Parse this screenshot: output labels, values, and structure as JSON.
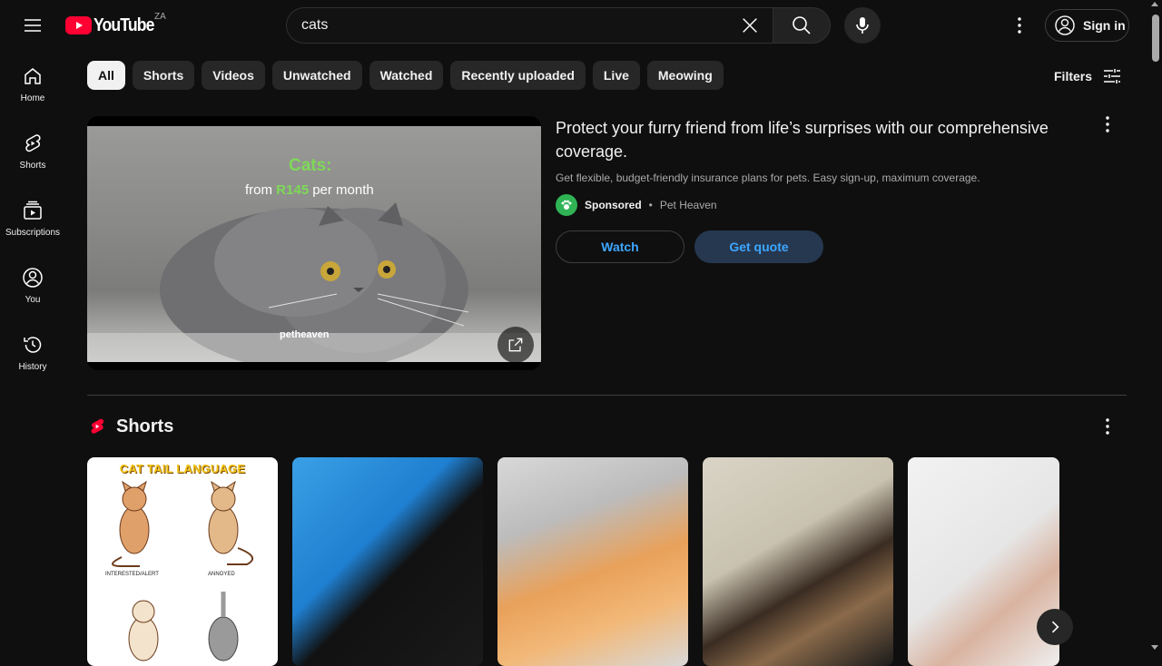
{
  "header": {
    "logo_text": "YouTube",
    "country_code": "ZA",
    "search_value": "cats",
    "signin_label": "Sign in"
  },
  "sidebar": {
    "items": [
      {
        "label": "Home",
        "icon": "home-icon"
      },
      {
        "label": "Shorts",
        "icon": "shorts-icon"
      },
      {
        "label": "Subscriptions",
        "icon": "subscriptions-icon"
      },
      {
        "label": "You",
        "icon": "you-icon"
      },
      {
        "label": "History",
        "icon": "history-icon"
      }
    ]
  },
  "chips": [
    "All",
    "Shorts",
    "Videos",
    "Unwatched",
    "Watched",
    "Recently uploaded",
    "Live",
    "Meowing"
  ],
  "filters_label": "Filters",
  "ad": {
    "thumb_headline": "Cats:",
    "thumb_sub_prefix": "from ",
    "thumb_price": "R145",
    "thumb_sub_suffix": " per month",
    "thumb_brand": "petheaven",
    "title": "Protect your furry friend from life’s surprises with our comprehensive coverage.",
    "description": "Get flexible, budget-friendly insurance plans for pets. Easy sign-up, maximum coverage.",
    "sponsored_label": "Sponsored",
    "separator": "•",
    "advertiser": "Pet Heaven",
    "watch_label": "Watch",
    "quote_label": "Get quote"
  },
  "shorts": {
    "heading": "Shorts",
    "first_title": "CAT TAIL LANGUAGE",
    "first_label_1": "INTERESTED/ALERT",
    "first_label_2": "ANNOYED"
  },
  "colors": {
    "background": "#0f0f0f",
    "brand_red": "#ff0033",
    "link_blue": "#3ea6ff",
    "chip_bg": "#272727"
  }
}
